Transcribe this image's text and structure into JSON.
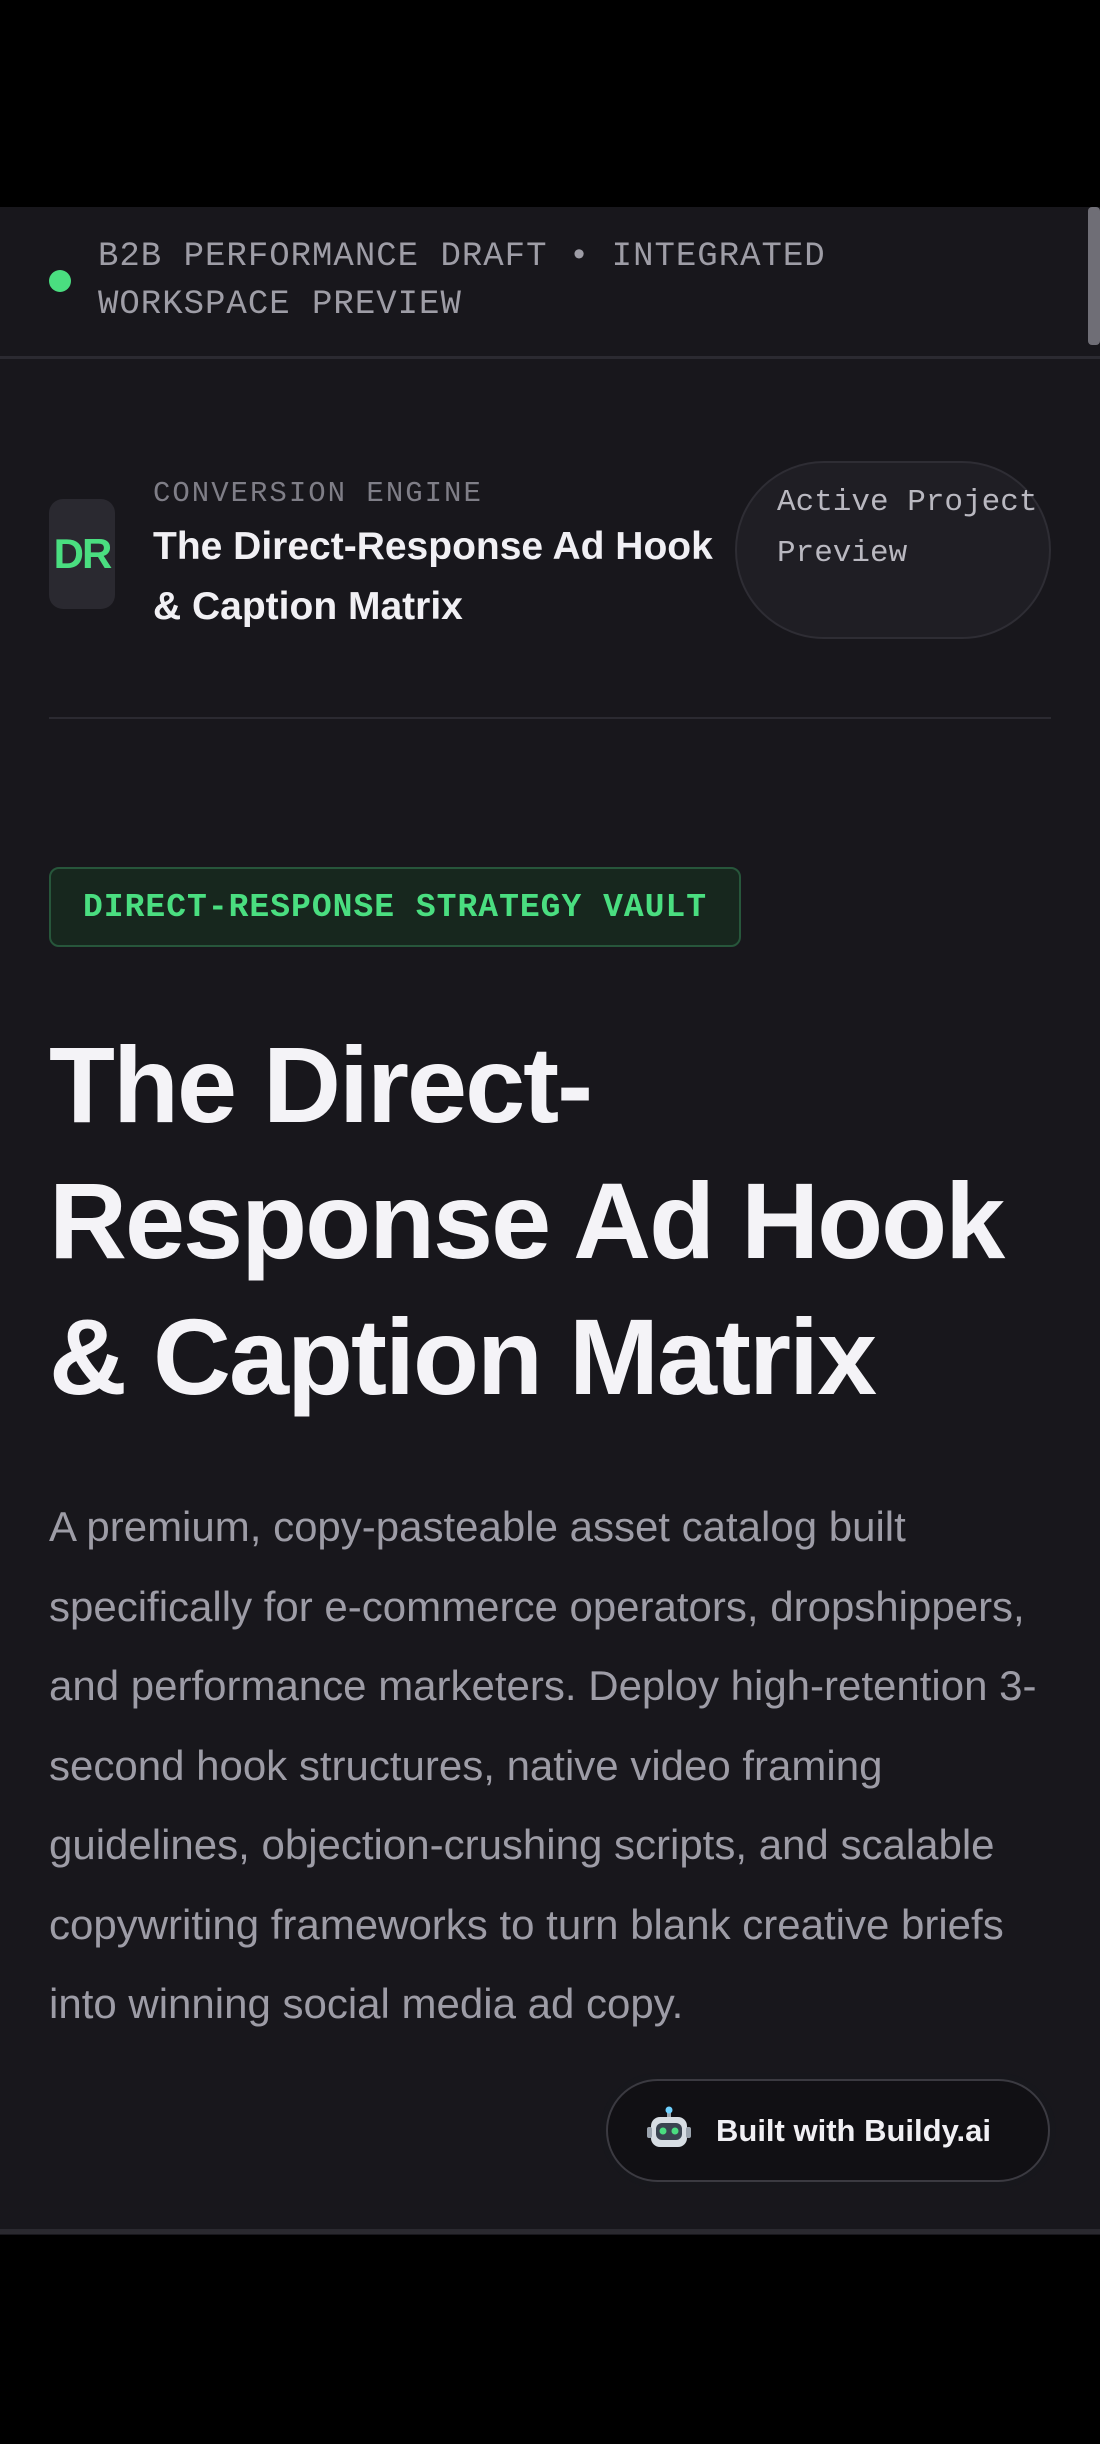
{
  "banner": {
    "text": "B2B PERFORMANCE DRAFT • INTEGRATED WORKSPACE PREVIEW",
    "status_color": "#4ade80"
  },
  "header": {
    "logo_text": "DR",
    "eyebrow": "CONVERSION ENGINE",
    "title": "The Direct-Response Ad Hook & Caption Matrix",
    "status_pill": "Active Project Preview"
  },
  "hero": {
    "tag": "DIRECT-RESPONSE STRATEGY VAULT",
    "title": "The Direct-Response Ad Hook & Caption Matrix",
    "description": "A premium, copy-pasteable asset catalog built specifically for e-commerce operators, dropshippers, and performance marketers. Deploy high-retention 3-second hook structures, native video framing guidelines, objection-crushing scripts, and scalable copywriting frameworks to turn blank creative briefs into winning social media ad copy."
  },
  "floating_button": {
    "label": "Built with Buildy.ai",
    "icon": "robot-icon"
  },
  "colors": {
    "accent": "#4ade80",
    "background": "#18171c",
    "text_primary": "#f4f3f7",
    "text_secondary": "#9d9ca6"
  }
}
